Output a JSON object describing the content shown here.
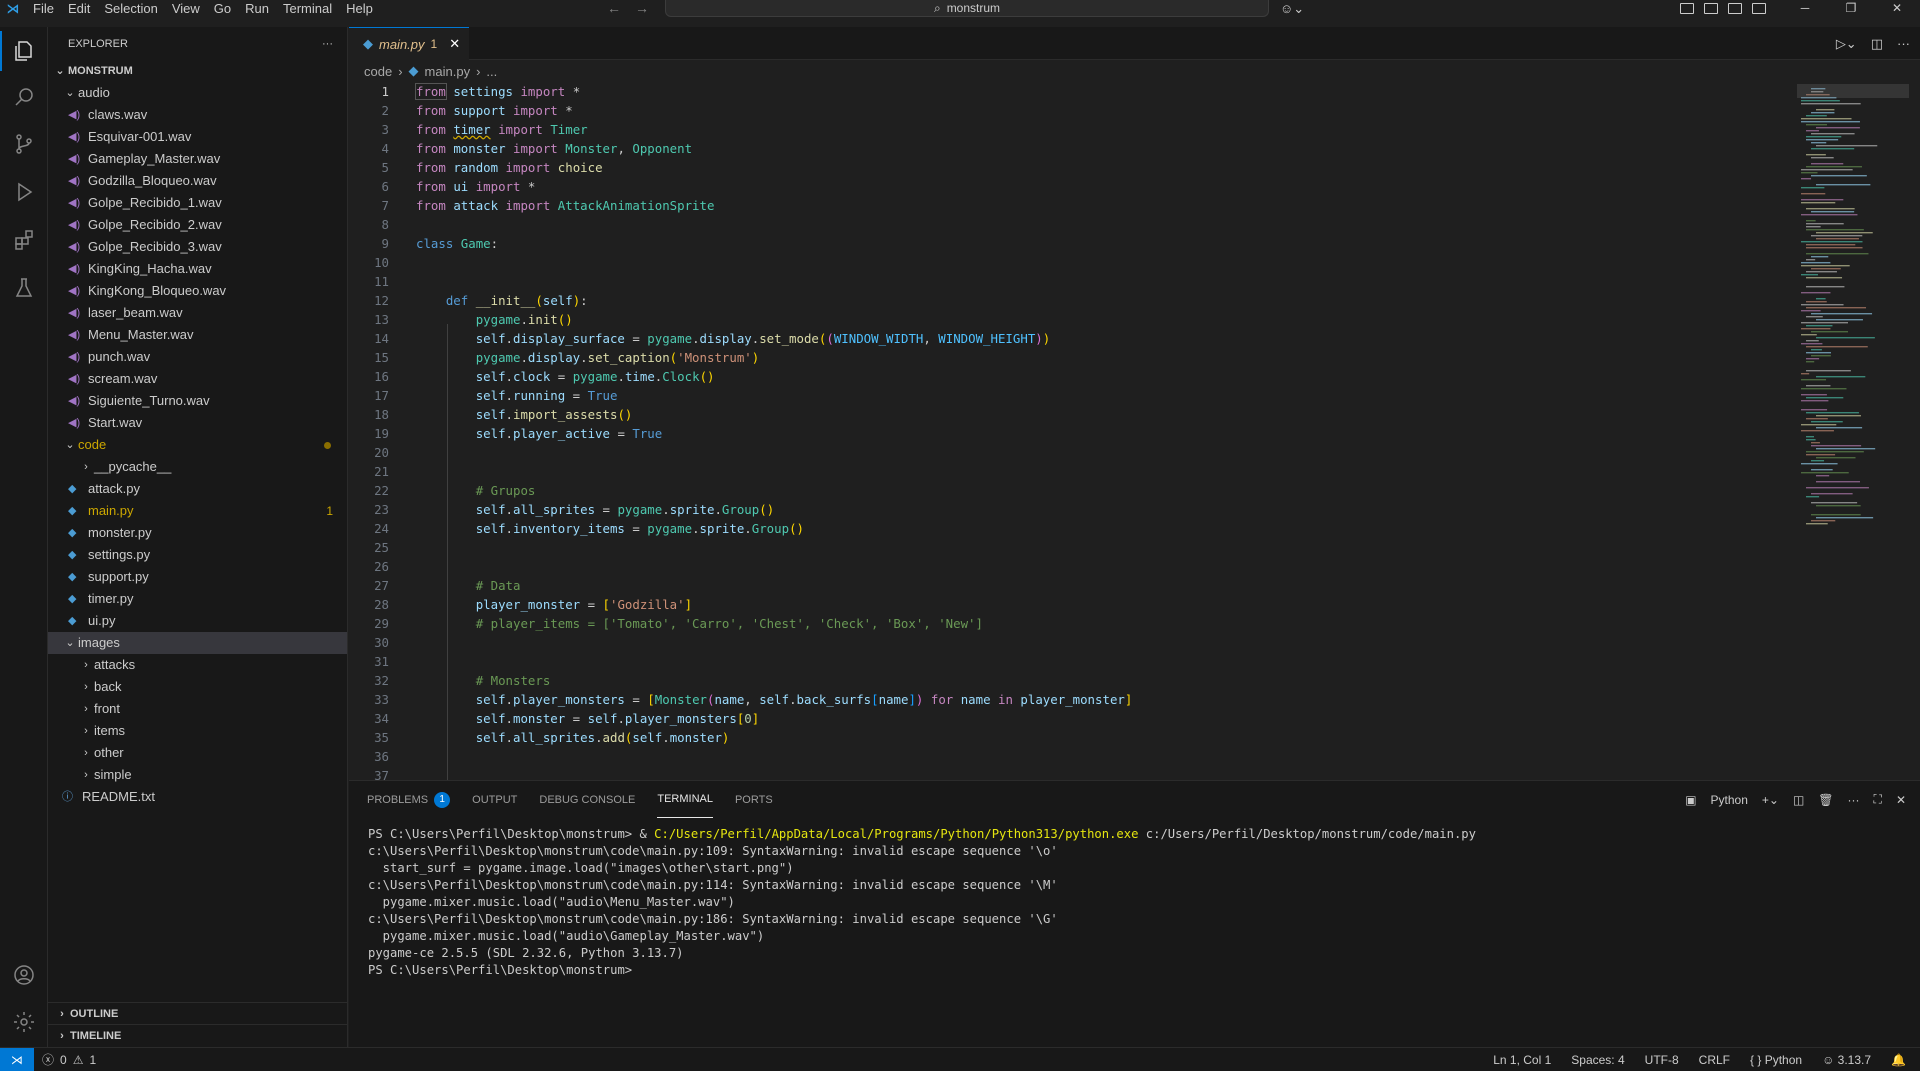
{
  "titlebar": {
    "menus": [
      "File",
      "Edit",
      "Selection",
      "View",
      "Go",
      "Run",
      "Terminal",
      "Help"
    ],
    "search": "monstrum"
  },
  "sidebar": {
    "title": "EXPLORER",
    "root": "MONSTRUM",
    "audio_folder": "audio",
    "audio_files": [
      "claws.wav",
      "Esquivar-001.wav",
      "Gameplay_Master.wav",
      "Godzilla_Bloqueo.wav",
      "Golpe_Recibido_1.wav",
      "Golpe_Recibido_2.wav",
      "Golpe_Recibido_3.wav",
      "KingKing_Hacha.wav",
      "KingKong_Bloqueo.wav",
      "laser_beam.wav",
      "Menu_Master.wav",
      "punch.wav",
      "scream.wav",
      "Siguiente_Turno.wav",
      "Start.wav"
    ],
    "code_folder": "code",
    "code_items": [
      "__pycache__",
      "attack.py",
      "main.py",
      "monster.py",
      "settings.py",
      "support.py",
      "timer.py",
      "ui.py"
    ],
    "main_problems": "1",
    "images_folder": "images",
    "image_folders": [
      "attacks",
      "back",
      "front",
      "items",
      "other",
      "simple"
    ],
    "readme": "README.txt",
    "outline": "OUTLINE",
    "timeline": "TIMELINE"
  },
  "editor": {
    "tab_name": "main.py",
    "tab_count": "1",
    "breadcrumb": [
      "code",
      "main.py",
      "..."
    ],
    "current_line": "1"
  },
  "code": [
    "1",
    "2",
    "3",
    "4",
    "5",
    "6",
    "7",
    "8",
    "9",
    "10",
    "11",
    "12",
    "13",
    "14",
    "15",
    "16",
    "17",
    "18",
    "19",
    "20",
    "21",
    "22",
    "23",
    "24",
    "25",
    "26",
    "27",
    "28",
    "29",
    "30",
    "31",
    "32",
    "33",
    "34",
    "35",
    "36",
    "37"
  ],
  "panel": {
    "tabs": [
      "PROBLEMS",
      "OUTPUT",
      "DEBUG CONSOLE",
      "TERMINAL",
      "PORTS"
    ],
    "problems_count": "1",
    "terminal_label": "Python",
    "lines": [
      "PS C:\\Users\\Perfil\\Desktop\\monstrum> & ",
      "C:/Users/Perfil/AppData/Local/Programs/Python/Python313/python.exe",
      " c:/Users/Perfil/Desktop/monstrum/code/main.py",
      "c:\\Users\\Perfil\\Desktop\\monstrum\\code\\main.py:109: SyntaxWarning: invalid escape sequence '\\o'",
      "  start_surf = pygame.image.load(\"images\\other\\start.png\")",
      "c:\\Users\\Perfil\\Desktop\\monstrum\\code\\main.py:114: SyntaxWarning: invalid escape sequence '\\M'",
      "  pygame.mixer.music.load(\"audio\\Menu_Master.wav\")",
      "c:\\Users\\Perfil\\Desktop\\monstrum\\code\\main.py:186: SyntaxWarning: invalid escape sequence '\\G'",
      "  pygame.mixer.music.load(\"audio\\Gameplay_Master.wav\")",
      "pygame-ce 2.5.5 (SDL 2.32.6, Python 3.13.7)",
      "PS C:\\Users\\Perfil\\Desktop\\monstrum> "
    ]
  },
  "statusbar": {
    "errors": "0",
    "warnings": "1",
    "position": "Ln 1, Col 1",
    "spaces": "Spaces: 4",
    "encoding": "UTF-8",
    "eol": "CRLF",
    "language": "Python",
    "version": "3.13.7"
  },
  "colors": {
    "accent": "#0078d4",
    "modified": "#e2c08d",
    "keyword": "#c586c0",
    "string": "#ce9178",
    "comment": "#6a9955"
  }
}
